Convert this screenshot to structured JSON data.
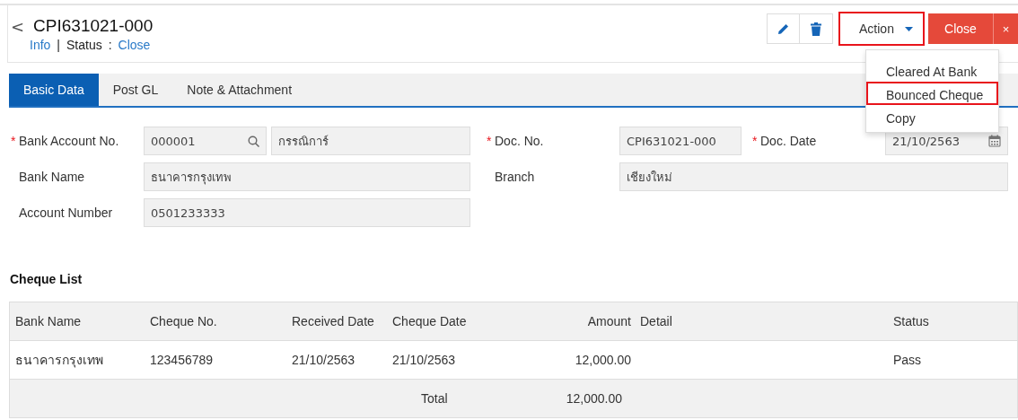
{
  "header": {
    "back": "<",
    "title": "CPI631021-000",
    "info_link": "Info",
    "separator": "|",
    "status_label": "Status",
    "status_colon": ":",
    "status_value": "Close"
  },
  "toolbar": {
    "action": {
      "label": "Action",
      "highlighted": true,
      "expanded": true
    },
    "close": "Close",
    "close_x": "×"
  },
  "action_menu": [
    {
      "label": "Cleared At Bank",
      "selected": false
    },
    {
      "label": "Bounced Cheque",
      "selected": true
    },
    {
      "label": "Copy",
      "selected": false
    }
  ],
  "tabs": [
    {
      "label": "Basic Data",
      "selected": true
    },
    {
      "label": "Post GL",
      "selected": false
    },
    {
      "label": "Note & Attachment",
      "selected": false
    }
  ],
  "form": {
    "bank_account_no": {
      "required_mark": "*",
      "label": "Bank Account No.",
      "code": "000001",
      "name": "กรรณิการ์"
    },
    "doc_no": {
      "required_mark": "*",
      "label": "Doc. No.",
      "value": "CPI631021-000"
    },
    "doc_date": {
      "required_mark": "*",
      "label": "Doc. Date",
      "value": "21/10/2563"
    },
    "bank_name": {
      "label": "Bank Name",
      "value": "ธนาคารกรุงเทพ"
    },
    "branch": {
      "label": "Branch",
      "value": "เชียงใหม่"
    },
    "account_number": {
      "label": "Account Number",
      "value": "0501233333"
    }
  },
  "cheque_list": {
    "title": "Cheque List",
    "columns": [
      "Bank Name",
      "Cheque No.",
      "Received Date",
      "Cheque Date",
      "Amount",
      "Detail",
      "Status"
    ],
    "rows": [
      [
        "ธนาคารกรุงเทพ",
        "123456789",
        "21/10/2563",
        "21/10/2563",
        "12,000.00",
        "",
        "Pass"
      ]
    ],
    "total": {
      "label": "Total",
      "amount": "12,000.00"
    }
  }
}
